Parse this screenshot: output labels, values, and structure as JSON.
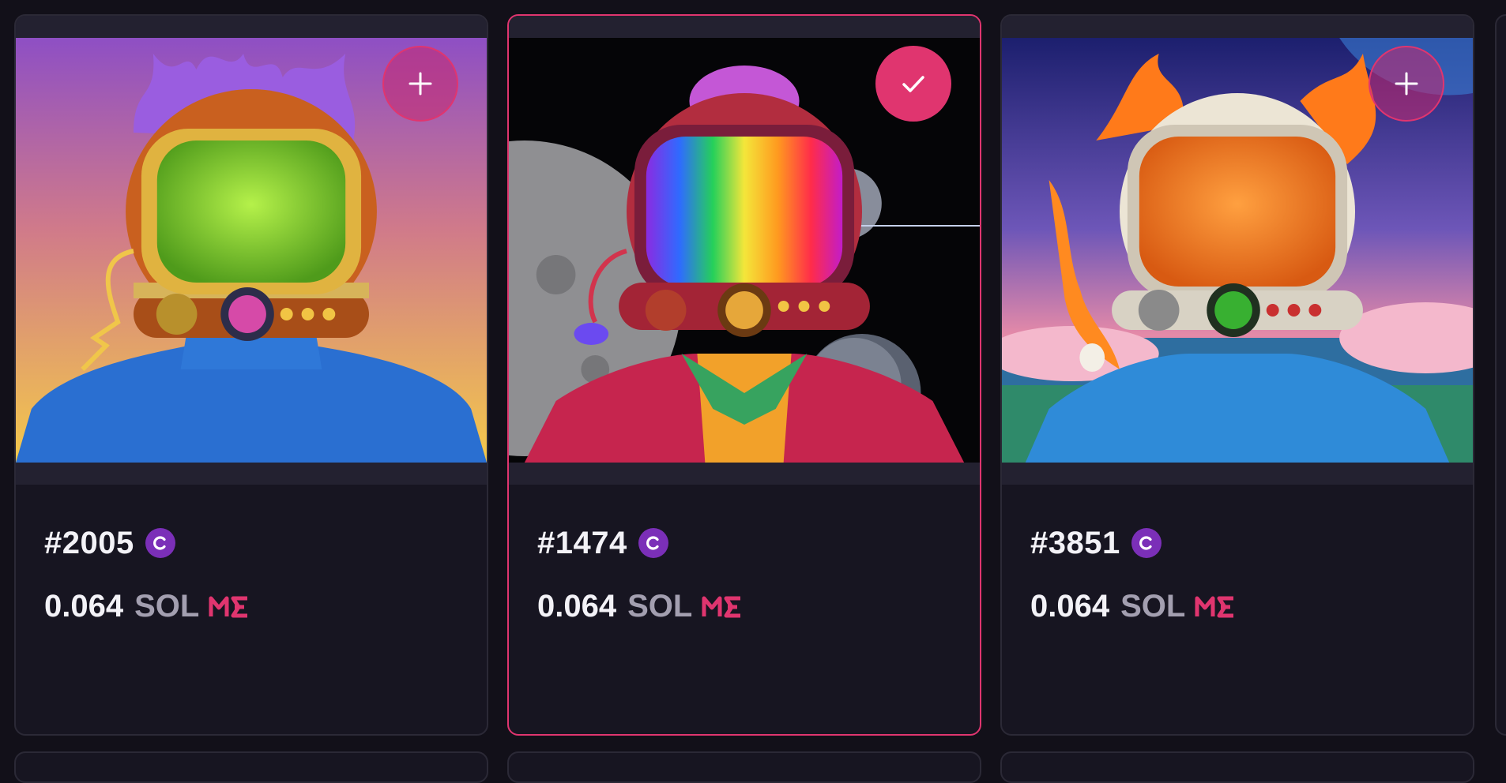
{
  "colors": {
    "background": "#121019",
    "card": "#171521",
    "accent_pink": "#e0356f",
    "badge_purple": "#7b2fb8",
    "text_primary": "#f3f2f7",
    "text_secondary": "#a39fb0"
  },
  "cards": [
    {
      "name": "#2005",
      "price": "0.064",
      "currency": "SOL",
      "selected": false,
      "action_icon": "plus-icon",
      "badge_icon": "c-badge-icon",
      "marketplace_icon": "magic-eden-logo-icon"
    },
    {
      "name": "#1474",
      "price": "0.064",
      "currency": "SOL",
      "selected": true,
      "action_icon": "checkmark-icon",
      "badge_icon": "c-badge-icon",
      "marketplace_icon": "magic-eden-logo-icon"
    },
    {
      "name": "#3851",
      "price": "0.064",
      "currency": "SOL",
      "selected": false,
      "action_icon": "plus-icon",
      "badge_icon": "c-badge-icon",
      "marketplace_icon": "magic-eden-logo-icon"
    }
  ]
}
